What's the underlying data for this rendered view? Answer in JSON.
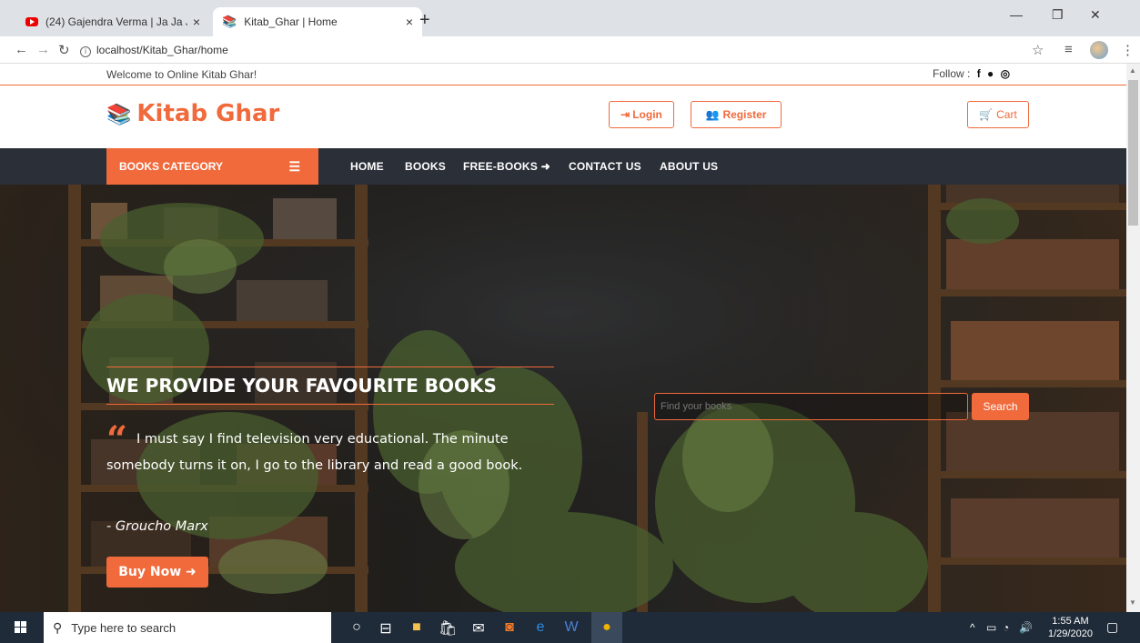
{
  "browser": {
    "tabs": [
      {
        "title": "(24) Gajendra Verma | Ja Ja Ja | V",
        "close": "×"
      },
      {
        "title": "Kitab_Ghar | Home",
        "close": "×"
      }
    ],
    "new_tab": "+",
    "url": "localhost/Kitab_Ghar/home"
  },
  "site": {
    "welcome": "Welcome to Online Kitab Ghar!",
    "follow_label": "Follow :",
    "logo": "Kitab Ghar",
    "login": "Login",
    "register": "Register",
    "cart": "Cart"
  },
  "nav": {
    "category": "BOOKS CATEGORY",
    "items": [
      "HOME",
      "BOOKS",
      "FREE-BOOKS",
      "CONTACT US",
      "ABOUT US"
    ]
  },
  "hero": {
    "title": "WE PROVIDE YOUR FAVOURITE BOOKS",
    "quote": "I must say I find television very educational. The minute somebody turns it on, I go to the library and read a good book.",
    "author": "- Groucho Marx",
    "buy_now": "Buy Now",
    "search_placeholder": "Find your books",
    "search_button": "Search"
  },
  "taskbar": {
    "search_placeholder": "Type here to search",
    "time": "1:55 AM",
    "date": "1/29/2020"
  },
  "colors": {
    "accent": "#f06a3c",
    "navbar": "#2b2f38",
    "taskbar": "#1f2b39"
  }
}
